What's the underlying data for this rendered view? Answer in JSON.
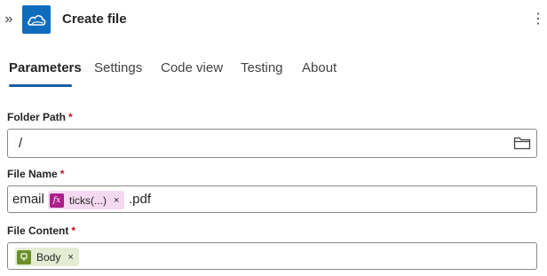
{
  "header": {
    "title": "Create file",
    "collapse_icon": "chevron-double-right-icon",
    "app_icon": "onedrive-cloud-icon",
    "more_icon": "more-vertical-icon",
    "accent": "#0f6cbd"
  },
  "tabs": [
    {
      "label": "Parameters",
      "active": true
    },
    {
      "label": "Settings"
    },
    {
      "label": "Code view"
    },
    {
      "label": "Testing"
    },
    {
      "label": "About"
    }
  ],
  "fields": {
    "folder_path": {
      "label": "Folder Path",
      "required": "*",
      "value": "/",
      "icon": "folder-icon"
    },
    "file_name": {
      "label": "File Name",
      "required": "*",
      "prefix": "email",
      "token": {
        "label": "ticks(...)",
        "icon_text": "fx",
        "remove": "×"
      },
      "suffix": ".pdf"
    },
    "file_content": {
      "label": "File Content",
      "required": "*",
      "token": {
        "label": "Body",
        "remove": "×"
      }
    }
  }
}
